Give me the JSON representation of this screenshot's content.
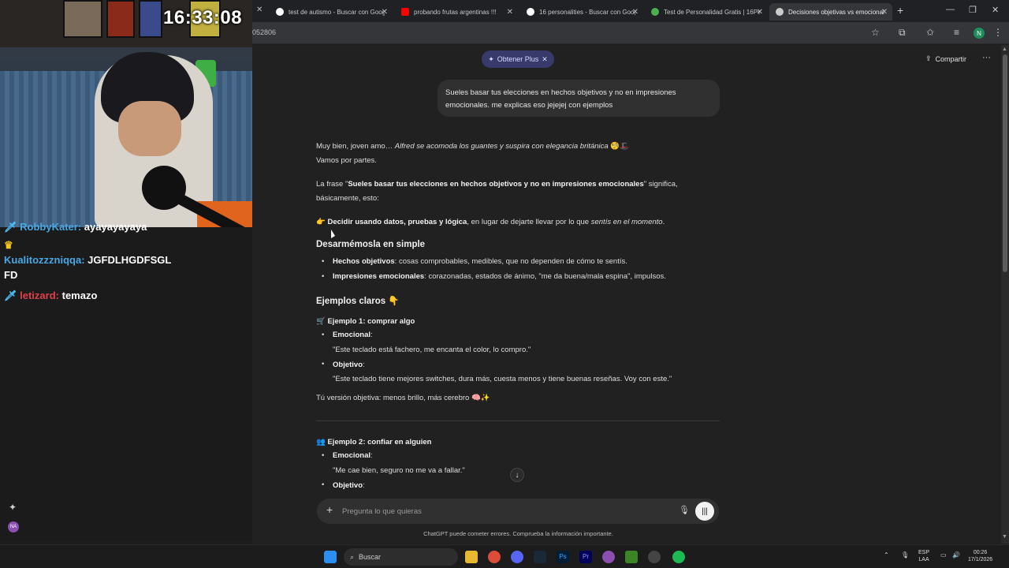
{
  "overlay": {
    "clock": "16:33:08",
    "chat": [
      {
        "user": "RobbyKater:",
        "text": "ayayayayaya",
        "badge": "sword"
      },
      {
        "user": "",
        "text": "",
        "badge": "crown"
      },
      {
        "user": "Kualitozzzniqqa:",
        "text": "JGFDLHGDFSGL",
        "badge": ""
      },
      {
        "user": "",
        "text": "FD",
        "badge": ""
      },
      {
        "user": "letizard:",
        "text": "temazo",
        "badge": "sword"
      }
    ],
    "avatar_initials": "NA"
  },
  "browser": {
    "tabs": [
      {
        "title": "test de autismo - Buscar con Google",
        "favicon_color": "#ffffff"
      },
      {
        "title": "probando frutas argentinas !!!",
        "favicon_color": "#ff0000"
      },
      {
        "title": "16 personalities - Buscar con Google",
        "favicon_color": "#ffffff"
      },
      {
        "title": "Test de Personalidad Gratis | 16Personalities",
        "favicon_color": "#4caf50"
      },
      {
        "title": "Decisiones objetivas vs emocionales",
        "favicon_color": "#cccccc"
      }
    ],
    "url": "052806",
    "profile_initial": "N"
  },
  "chatgpt": {
    "plus_button": "Obtener Plus",
    "share_label": "Compartir",
    "user_message": "Sueles basar tus elecciones en hechos objetivos y no en impresiones emocionales.  me explicas eso jejejej con ejemplos",
    "answer": {
      "intro_plain": "Muy bien, joven amo… ",
      "intro_italic": "Alfred se acomoda los guantes y suspira con elegancia británica",
      "intro_emoji": "🧐🎩",
      "intro_line2": "Vamos por partes.",
      "phrase_pre": "La frase \"",
      "phrase_bold": "Sueles basar tus elecciones en hechos objetivos y no en impresiones emocionales",
      "phrase_post": "\" significa,",
      "phrase_line2": "básicamente, esto:",
      "point_emoji": "👉",
      "point_bold": "Decidir usando datos, pruebas y lógica",
      "point_mid": ", en lugar de dejarte llevar por lo que ",
      "point_italic": "sentís en el momento",
      "point_end": ".",
      "h_simple": "Desarmémosla en simple",
      "bullets_simple": [
        {
          "term": "Hechos objetivos",
          "desc": ": cosas comprobables, medibles, que no dependen de cómo te sentís."
        },
        {
          "term": "Impresiones emocionales",
          "desc": ": corazonadas, estados de ánimo, \"me da buena/mala espina\", impulsos."
        }
      ],
      "h_examples": "Ejemplos claros 👇",
      "ex1_title": "🛒 Ejemplo 1: comprar algo",
      "ex1_emotional_label": "Emocional",
      "ex1_emotional_text": "\"Este teclado está fachero, me encanta el color, lo compro.\"",
      "ex1_objective_label": "Objetivo",
      "ex1_objective_text": "\"Este teclado tiene mejores switches, dura más, cuesta menos y tiene buenas reseñas. Voy con este.\"",
      "ex1_summary": "Tú versión objetiva: menos brillo, más cerebro 🧠✨",
      "ex2_title": "👥 Ejemplo 2: confiar en alguien",
      "ex2_emotional_label": "Emocional",
      "ex2_emotional_text": "\"Me cae bien, seguro no me va a fallar.\"",
      "ex2_objective_label": "Objetivo"
    },
    "composer_placeholder": "Pregunta lo que quieras",
    "disclaimer": "ChatGPT puede cometer errores. Comprueba la información importante."
  },
  "taskbar": {
    "search_label": "Buscar",
    "lang_top": "ESP",
    "lang_bottom": "LAA",
    "time": "00:26",
    "date": "17/1/2026"
  }
}
